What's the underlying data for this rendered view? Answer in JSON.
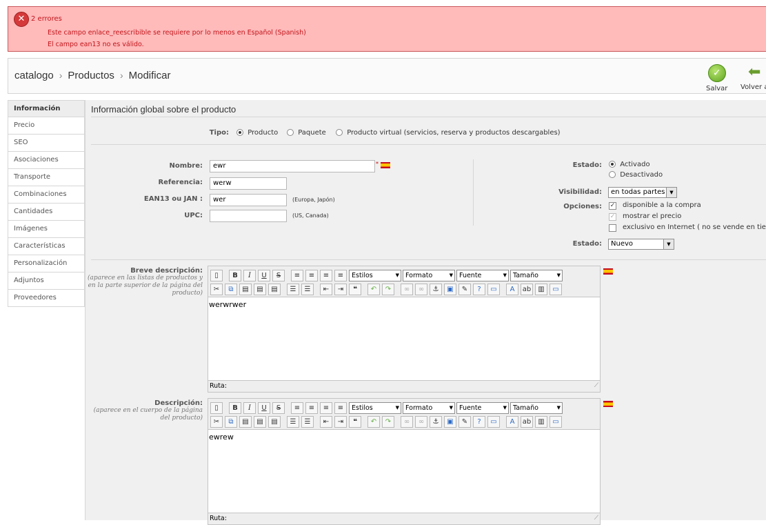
{
  "errors": {
    "title": "2 errores",
    "messages": [
      "Este campo enlace_reescribible se requiere por lo menos en Español (Spanish)",
      "El campo ean13 no es válido."
    ]
  },
  "breadcrumb": [
    "catalogo",
    "Productos",
    "Modificar"
  ],
  "toolbar": {
    "save_label": "Salvar",
    "back_label": "Volver a"
  },
  "sidebar": {
    "tabs": [
      "Información",
      "Precio",
      "SEO",
      "Asociaciones",
      "Transporte",
      "Combinaciones",
      "Cantidades",
      "Imágenes",
      "Características",
      "Personalización",
      "Adjuntos",
      "Proveedores"
    ]
  },
  "main": {
    "section_title": "Información global sobre el producto",
    "type": {
      "label": "Tipo:",
      "options": [
        "Producto",
        "Paquete",
        "Producto virtual (servicios, reserva y productos descargables)"
      ],
      "selected": "Producto"
    },
    "fields": {
      "name_label": "Nombre:",
      "name_value": "ewr",
      "ref_label": "Referencia:",
      "ref_value": "werw",
      "ean_label": "EAN13 ou JAN :",
      "ean_value": "wer",
      "ean_hint": "(Europa, Japón)",
      "upc_label": "UPC:",
      "upc_value": "",
      "upc_hint": "(US, Canada)"
    },
    "status": {
      "label": "Estado:",
      "options": [
        "Activado",
        "Desactivado"
      ],
      "selected": "Activado"
    },
    "visibility": {
      "label": "Visibilidad:",
      "value": "en todas partes"
    },
    "options": {
      "label": "Opciones:",
      "items": [
        {
          "text": "disponible a la compra",
          "checked": true
        },
        {
          "text": "mostrar el precio",
          "checked": true
        },
        {
          "text": "exclusivo en Internet ( no se vende en tienda",
          "checked": false
        }
      ]
    },
    "condition": {
      "label": "Estado:",
      "value": "Nuevo"
    },
    "editor_toolbar": {
      "styles": "Estilos",
      "format": "Formato",
      "font": "Fuente",
      "size": "Tamaño",
      "path_label": "Ruta:"
    },
    "short_description": {
      "label": "Breve descripción:",
      "hint": "(aparece en las listas de productos y en la parte superior de la página del producto)",
      "content": "werwrwer"
    },
    "description": {
      "label": "Descripción:",
      "hint": "(aparece en el cuerpo de la página del producto)",
      "content": "ewrew"
    }
  },
  "colors": {
    "error_bg": "#ffbaba",
    "error_text": "#c1141a",
    "save_green": "#5ea31f"
  }
}
